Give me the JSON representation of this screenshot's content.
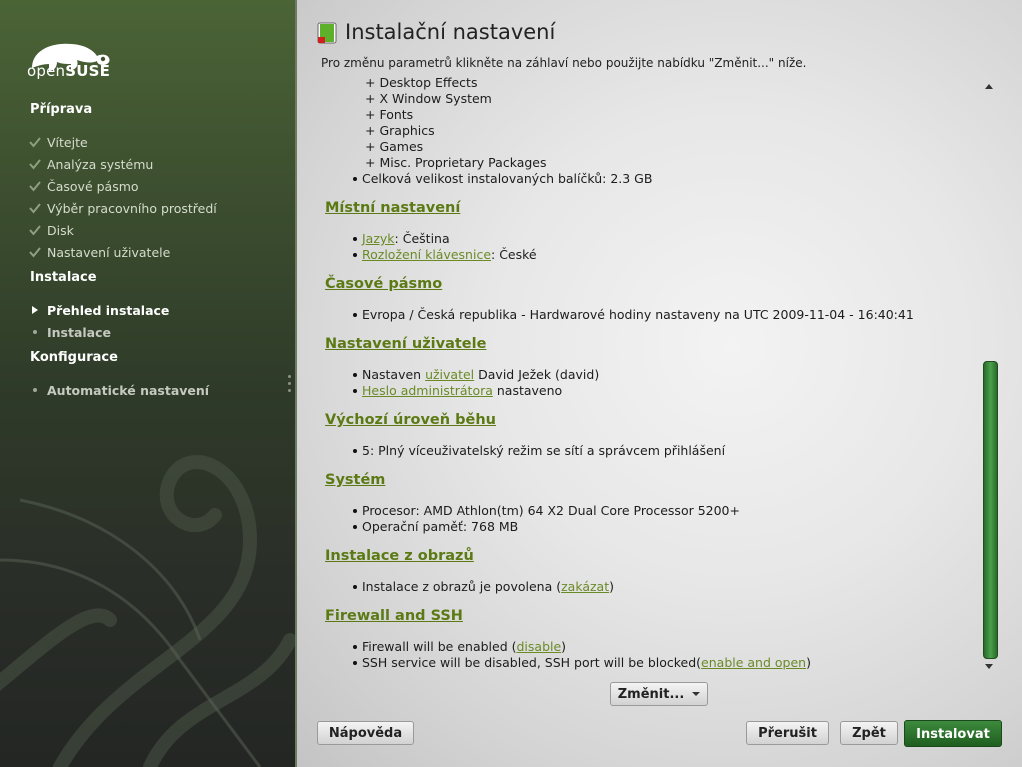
{
  "sidebar": {
    "logo_text_light": "open",
    "logo_text_bold": "SUSE",
    "sections": [
      {
        "title": "Příprava",
        "steps": [
          {
            "label": "Vítejte",
            "state": "done"
          },
          {
            "label": "Analýza systému",
            "state": "done"
          },
          {
            "label": "Časové pásmo",
            "state": "done"
          },
          {
            "label": "Výběr pracovního prostředí",
            "state": "done"
          },
          {
            "label": "Disk",
            "state": "done"
          },
          {
            "label": "Nastavení uživatele",
            "state": "done"
          }
        ]
      },
      {
        "title": "Instalace",
        "steps": [
          {
            "label": "Přehled instalace",
            "state": "current"
          },
          {
            "label": "Instalace",
            "state": "pending"
          }
        ]
      },
      {
        "title": "Konfigurace",
        "steps": [
          {
            "label": "Automatické nastavení",
            "state": "pending"
          }
        ]
      }
    ]
  },
  "main": {
    "title": "Instalační nastavení",
    "subtitle": "Pro změnu parametrů klikněte na záhlaví nebo použijte nabídku \"Změnit...\" níže.",
    "packages": {
      "items": [
        "Desktop Effects",
        "X Window System",
        "Fonts",
        "Graphics",
        "Games",
        "Misc. Proprietary Packages"
      ],
      "size_text": "Celková velikost instalovaných balíčků: 2.3 GB"
    },
    "locale": {
      "heading": "Místní nastavení",
      "lang_link": "Jazyk",
      "lang_value": ": Čeština",
      "kb_link": "Rozložení klávesnice",
      "kb_value": ": České"
    },
    "timezone": {
      "heading": "Časové pásmo",
      "value": "Evropa / Česká republika - Hardwarové hodiny nastaveny na UTC 2009-11-04 - 16:40:41"
    },
    "user": {
      "heading": "Nastavení uživatele",
      "prefix": "Nastaven ",
      "user_link": "uživatel",
      "user_suffix": " David Ježek (david)",
      "root_link": "Heslo administrátora",
      "root_suffix": " nastaveno"
    },
    "runlevel": {
      "heading": "Výchozí úroveň běhu",
      "value": "5: Plný víceuživatelský režim se sítí a správcem přihlášení"
    },
    "system": {
      "heading": "Systém",
      "cpu": "Procesor: AMD Athlon(tm) 64 X2 Dual Core Processor 5200+",
      "mem": "Operační paměť: 768 MB"
    },
    "images": {
      "heading": "Instalace z obrazů",
      "prefix": "Instalace z obrazů je povolena (",
      "link": "zakázat",
      "suffix": ")"
    },
    "firewall": {
      "heading": "Firewall and SSH",
      "fw_prefix": "Firewall will be enabled (",
      "fw_link": "disable",
      "fw_suffix": ")",
      "ssh_prefix": "SSH service will be disabled, SSH port will be blocked(",
      "ssh_link": "enable and open",
      "ssh_suffix": ")"
    },
    "change_button": "Změnit...",
    "buttons": {
      "help": "Nápověda",
      "abort": "Přerušit",
      "back": "Zpět",
      "install": "Instalovat"
    }
  },
  "colors": {
    "accent": "#5c7a14",
    "link": "#6a8a26",
    "install_button": "#2a702a"
  }
}
